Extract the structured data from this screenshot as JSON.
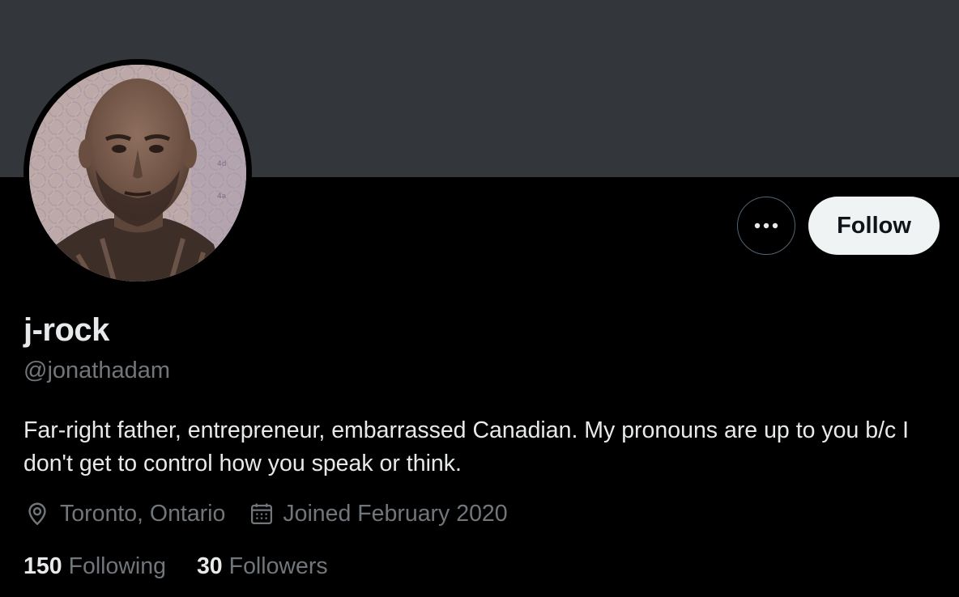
{
  "profile": {
    "display_name": "j-rock",
    "handle": "@jonathadam",
    "bio": "Far-right father, entrepreneur, embarrassed Canadian. My pronouns are up to you b/c I don't get to control how you speak or think.",
    "location": "Toronto, Ontario",
    "joined": "Joined February 2020",
    "following_count": "150",
    "following_label": "Following",
    "followers_count": "30",
    "followers_label": "Followers"
  },
  "actions": {
    "follow_label": "Follow",
    "more_icon": "more-horizontal-icon"
  },
  "colors": {
    "banner": "#33363a",
    "background": "#000000",
    "primary_text": "#e7e9ea",
    "secondary_text": "#71767b",
    "follow_button_bg": "#eff3f4"
  },
  "icons": {
    "location": "location-pin-icon",
    "calendar": "calendar-icon"
  }
}
